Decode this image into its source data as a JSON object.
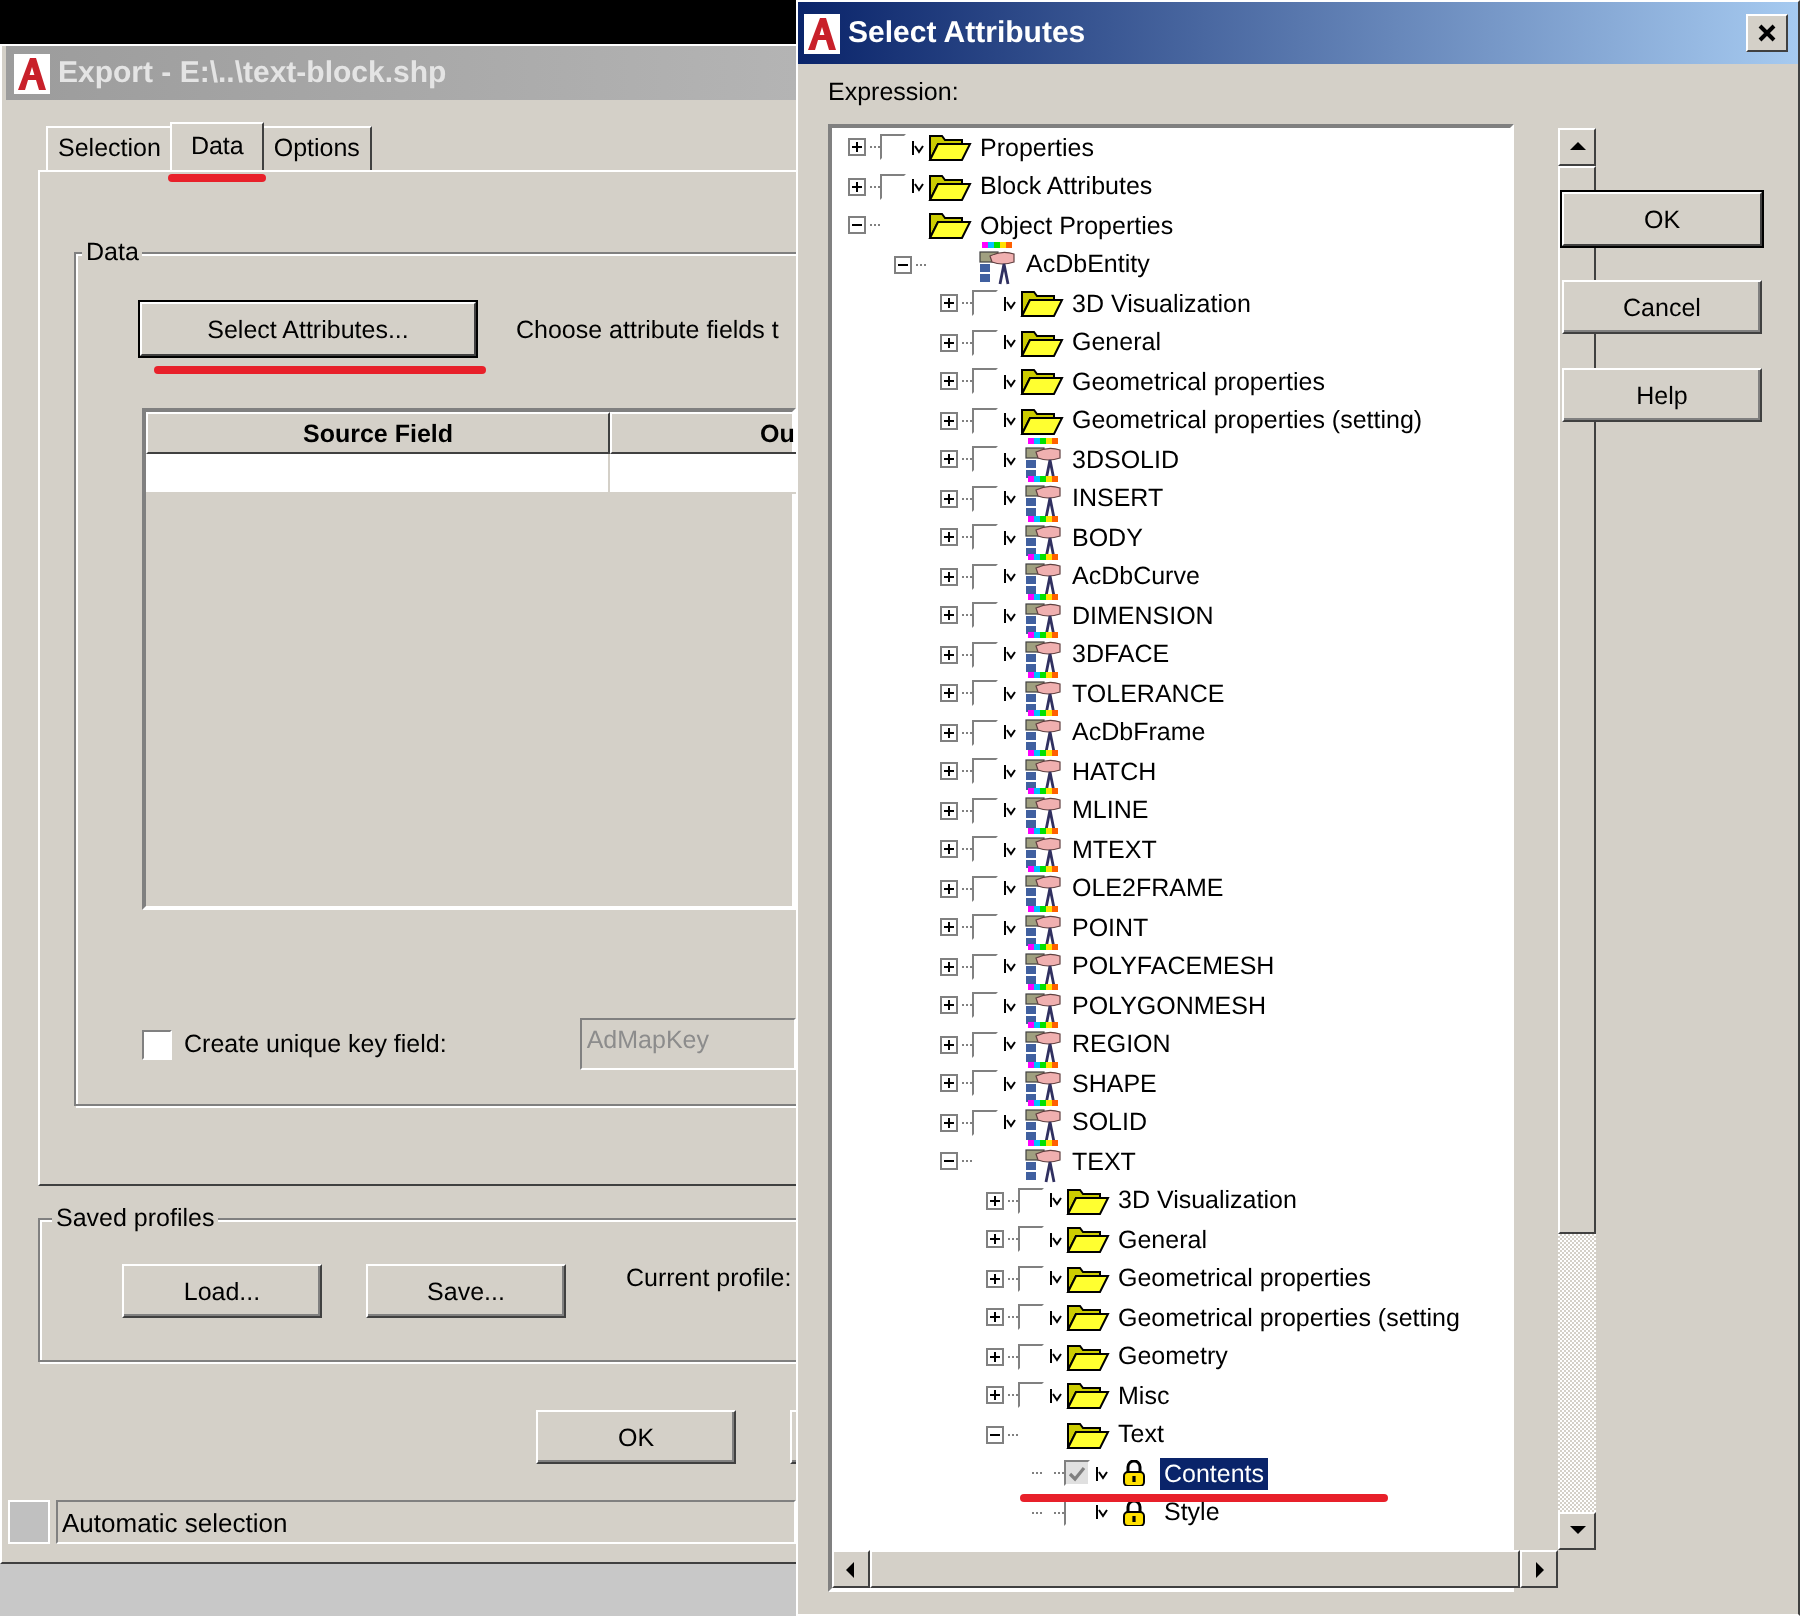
{
  "export_window": {
    "title": "Export - E:\\..\\text-block.shp",
    "tabs": [
      {
        "label": "Selection",
        "selected": false,
        "underlined": false
      },
      {
        "label": "Data",
        "selected": true,
        "underlined": true
      },
      {
        "label": "Options",
        "selected": false,
        "underlined": false
      }
    ],
    "data_group": {
      "title": "Data",
      "select_button": {
        "label": "Select Attributes...",
        "underlined": true
      },
      "hint": "Choose attribute fields t",
      "table": {
        "columns": [
          "Source Field",
          "Ou"
        ]
      },
      "unique_key": {
        "label": "Create unique key field:",
        "checked": false,
        "value": "AdMapKey",
        "disabled": true
      }
    },
    "profiles_group": {
      "title": "Saved profiles",
      "buttons": [
        "Load...",
        "Save..."
      ],
      "current_label": "Current profile:"
    },
    "buttons": [
      "OK"
    ],
    "status_bar": "Automatic selection"
  },
  "select_window": {
    "title": "Select Attributes",
    "expression_label": "Expression:",
    "tree": [
      {
        "label": "Properties",
        "kind": "folder",
        "expanded": false,
        "checked": false,
        "selected": false
      },
      {
        "label": "Block Attributes",
        "kind": "folder",
        "expanded": false,
        "checked": false,
        "selected": false
      },
      {
        "label": "Object Properties",
        "kind": "folder",
        "expanded": true,
        "selected": false,
        "children": [
          {
            "label": "AcDbEntity",
            "kind": "entity",
            "expanded": true,
            "selected": false,
            "children": [
              {
                "label": "3D Visualization",
                "kind": "folder",
                "expanded": false,
                "checked": false,
                "selected": false
              },
              {
                "label": "General",
                "kind": "folder",
                "expanded": false,
                "checked": false,
                "selected": false
              },
              {
                "label": "Geometrical properties",
                "kind": "folder",
                "expanded": false,
                "checked": false,
                "selected": false
              },
              {
                "label": "Geometrical properties (setting)",
                "kind": "folder",
                "expanded": false,
                "checked": false,
                "selected": false
              },
              {
                "label": "3DSOLID",
                "kind": "entity",
                "expanded": false,
                "checked": false,
                "selected": false
              },
              {
                "label": "INSERT",
                "kind": "entity",
                "expanded": false,
                "checked": false,
                "selected": false
              },
              {
                "label": "BODY",
                "kind": "entity",
                "expanded": false,
                "checked": false,
                "selected": false
              },
              {
                "label": "AcDbCurve",
                "kind": "entity",
                "expanded": false,
                "checked": false,
                "selected": false
              },
              {
                "label": "DIMENSION",
                "kind": "entity",
                "expanded": false,
                "checked": false,
                "selected": false
              },
              {
                "label": "3DFACE",
                "kind": "entity",
                "expanded": false,
                "checked": false,
                "selected": false
              },
              {
                "label": "TOLERANCE",
                "kind": "entity",
                "expanded": false,
                "checked": false,
                "selected": false
              },
              {
                "label": "AcDbFrame",
                "kind": "entity",
                "expanded": false,
                "checked": false,
                "selected": false
              },
              {
                "label": "HATCH",
                "kind": "entity",
                "expanded": false,
                "checked": false,
                "selected": false
              },
              {
                "label": "MLINE",
                "kind": "entity",
                "expanded": false,
                "checked": false,
                "selected": false
              },
              {
                "label": "MTEXT",
                "kind": "entity",
                "expanded": false,
                "checked": false,
                "selected": false
              },
              {
                "label": "OLE2FRAME",
                "kind": "entity",
                "expanded": false,
                "checked": false,
                "selected": false
              },
              {
                "label": "POINT",
                "kind": "entity",
                "expanded": false,
                "checked": false,
                "selected": false
              },
              {
                "label": "POLYFACEMESH",
                "kind": "entity",
                "expanded": false,
                "checked": false,
                "selected": false
              },
              {
                "label": "POLYGONMESH",
                "kind": "entity",
                "expanded": false,
                "checked": false,
                "selected": false
              },
              {
                "label": "REGION",
                "kind": "entity",
                "expanded": false,
                "checked": false,
                "selected": false
              },
              {
                "label": "SHAPE",
                "kind": "entity",
                "expanded": false,
                "checked": false,
                "selected": false
              },
              {
                "label": "SOLID",
                "kind": "entity",
                "expanded": false,
                "checked": false,
                "selected": false
              },
              {
                "label": "TEXT",
                "kind": "entity",
                "expanded": true,
                "selected": false,
                "children": [
                  {
                    "label": "3D Visualization",
                    "kind": "folder",
                    "expanded": false,
                    "checked": false,
                    "selected": false
                  },
                  {
                    "label": "General",
                    "kind": "folder",
                    "expanded": false,
                    "checked": false,
                    "selected": false
                  },
                  {
                    "label": "Geometrical properties",
                    "kind": "folder",
                    "expanded": false,
                    "checked": false,
                    "selected": false
                  },
                  {
                    "label": "Geometrical properties (setting",
                    "kind": "folder",
                    "expanded": false,
                    "checked": false,
                    "selected": false
                  },
                  {
                    "label": "Geometry",
                    "kind": "folder",
                    "expanded": false,
                    "checked": false,
                    "selected": false
                  },
                  {
                    "label": "Misc",
                    "kind": "folder",
                    "expanded": false,
                    "checked": false,
                    "selected": false
                  },
                  {
                    "label": "Text",
                    "kind": "folder",
                    "expanded": true,
                    "selected": false,
                    "children": [
                      {
                        "label": "Contents",
                        "kind": "field",
                        "checked": true,
                        "selected": true,
                        "underlined": true
                      },
                      {
                        "label": "Style",
                        "kind": "field",
                        "checked": false,
                        "selected": false,
                        "underlined": false
                      }
                    ]
                  }
                ]
              }
            ]
          }
        ]
      }
    ],
    "buttons": [
      "OK",
      "Cancel",
      "Help"
    ]
  }
}
